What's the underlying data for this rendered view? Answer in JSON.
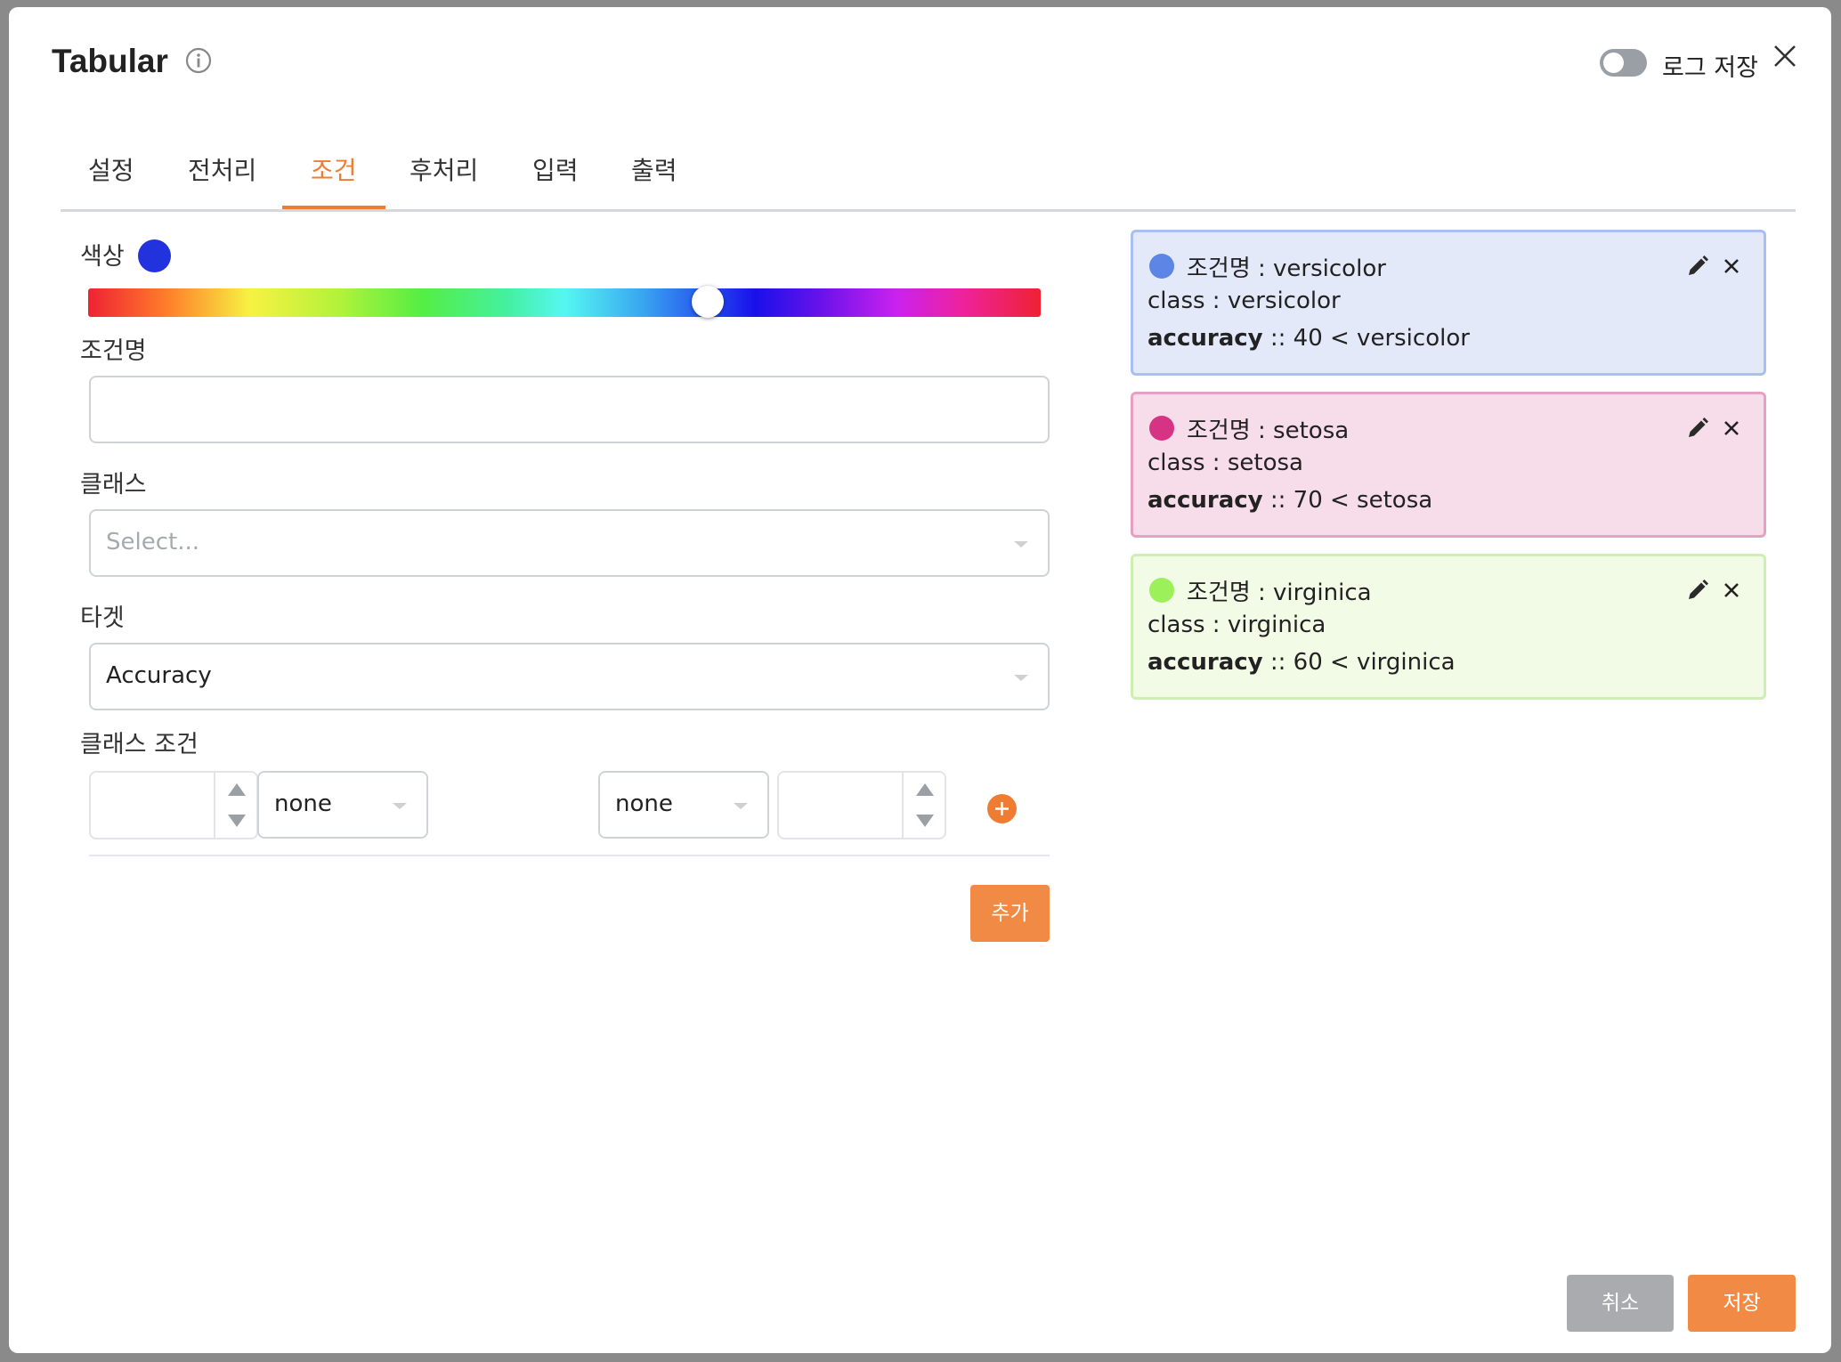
{
  "header": {
    "title": "Tabular",
    "log_toggle_label": "로그 저장",
    "log_toggle_on": false
  },
  "tabs": [
    {
      "label": "설정",
      "active": false
    },
    {
      "label": "전처리",
      "active": false
    },
    {
      "label": "조건",
      "active": true
    },
    {
      "label": "후처리",
      "active": false
    },
    {
      "label": "입력",
      "active": false
    },
    {
      "label": "출력",
      "active": false
    }
  ],
  "form": {
    "color_label": "색상",
    "selected_color": "#2233dd",
    "hue_position": 0.65,
    "condition_name_label": "조건명",
    "condition_name_value": "",
    "class_label": "클래스",
    "class_placeholder": "Select...",
    "target_label": "타겟",
    "target_value": "Accuracy",
    "class_condition_label": "클래스 조건",
    "left_number_value": "",
    "left_operator": "none",
    "right_operator": "none",
    "right_number_value": ""
  },
  "buttons": {
    "add": "추가",
    "cancel": "취소",
    "save": "저장"
  },
  "conditions": [
    {
      "name_label": "조건명 : versicolor",
      "class_line": "class : versicolor",
      "metric": "accuracy",
      "rule": " :: 40 < versicolor",
      "dot_color": "#5b86e5",
      "bg_color": "#e4e9fa",
      "border_color": "#a9bff0"
    },
    {
      "name_label": "조건명 : setosa",
      "class_line": "class : setosa",
      "metric": "accuracy",
      "rule": " :: 70 < setosa",
      "dot_color": "#d63384",
      "bg_color": "#f7dcea",
      "border_color": "#e6a0c4"
    },
    {
      "name_label": "조건명 : virginica",
      "class_line": "class : virginica",
      "metric": "accuracy",
      "rule": " :: 60 < virginica",
      "dot_color": "#9cf05a",
      "bg_color": "#f1fbe6",
      "border_color": "#cfeeb4"
    }
  ]
}
